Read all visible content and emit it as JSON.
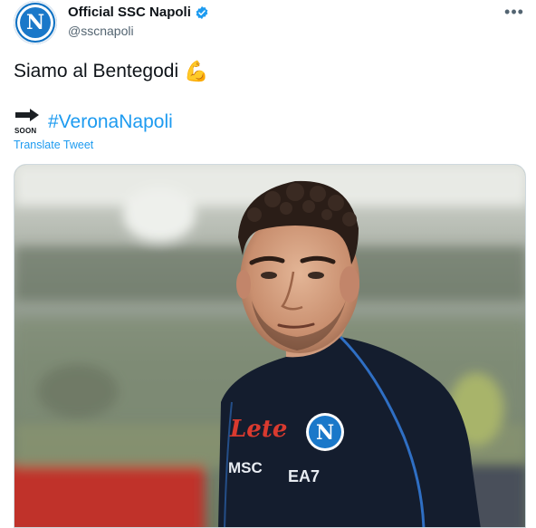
{
  "tweet": {
    "display_name": "Official SSC Napoli",
    "handle": "@sscnapoli",
    "verified": true,
    "avatar_letter": "N",
    "more_label": "•••",
    "text": "Siamo al Bentegodi",
    "emoji": "💪",
    "soon_label": "SOON",
    "hashtag": "#VeronaNapoli",
    "translate_label": "Translate Tweet"
  },
  "media": {
    "jersey_sponsor": "Lete",
    "jersey_brand": "MSC",
    "jersey_maker": "EA7",
    "badge_letter": "N"
  },
  "colors": {
    "link": "#1d9bf0",
    "text": "#0f1419",
    "secondary": "#536471",
    "napoli_blue": "#1a78c9"
  }
}
